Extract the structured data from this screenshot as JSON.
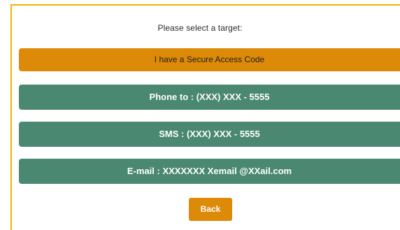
{
  "prompt": "Please select a target:",
  "options": [
    {
      "label": "I have a Secure Access Code"
    },
    {
      "label": "Phone to : (XXX) XXX - 5555"
    },
    {
      "label": "SMS : (XXX) XXX - 5555"
    },
    {
      "label": "E-mail : XXXXXXX Xemail @XXail.com"
    }
  ],
  "back_label": "Back",
  "colors": {
    "accent_orange": "#dc8a07",
    "option_green": "#4a8872",
    "panel_border": "#f0b400"
  }
}
